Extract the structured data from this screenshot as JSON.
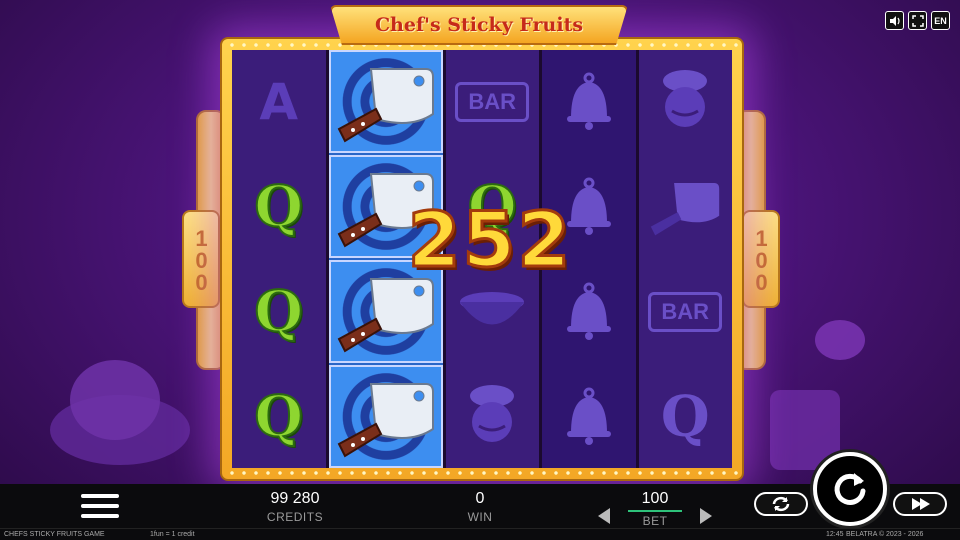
{
  "game": {
    "title": "Chef's Sticky Fruits",
    "side_value_left": "100",
    "side_value_right": "100",
    "win_amount": "252"
  },
  "top_controls": {
    "sound_icon": "speaker-icon",
    "fullscreen_icon": "fullscreen-icon",
    "language_label": "EN"
  },
  "reels": [
    [
      "A",
      "Q",
      "Q",
      "Q"
    ],
    [
      "cleaver",
      "cleaver",
      "cleaver",
      "cleaver"
    ],
    [
      "BAR",
      "Q",
      "cleaver-bowl",
      "chef"
    ],
    [
      "bell",
      "bell",
      "bell",
      "bell"
    ],
    [
      "chef",
      "cleaver",
      "BAR",
      "Q"
    ]
  ],
  "bottom": {
    "credits_value": "99 280",
    "credits_label": "CREDITS",
    "win_value": "0",
    "win_label": "WIN",
    "bet_value": "100",
    "bet_label": "BET"
  },
  "footer": {
    "game_name": "CHEFS STICKY FRUITS GAME",
    "rate": "1fun = 1 credit",
    "time": "12:45",
    "copyright": "BELATRA © 2023 - 2026"
  },
  "colors": {
    "accent_gold": "#ffd34d",
    "bet_underline": "#2ec27a",
    "background_purple": "#4a1478"
  }
}
